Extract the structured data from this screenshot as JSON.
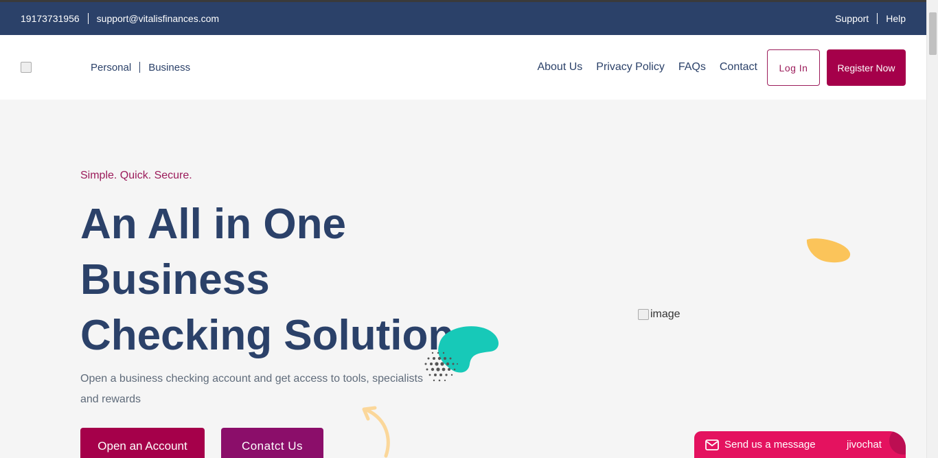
{
  "topbar": {
    "phone": "19173731956",
    "email": "support@vitalisfinances.com",
    "support": "Support",
    "help": "Help"
  },
  "header": {
    "segments": [
      "Personal",
      "Business"
    ],
    "nav": [
      "About Us",
      "Privacy Policy",
      "FAQs",
      "Contact"
    ],
    "login": "Log In",
    "register": "Register Now"
  },
  "hero": {
    "tagline": "Simple. Quick. Secure.",
    "title_lines": [
      "An All in One",
      "Business",
      "Checking Solution"
    ],
    "description": "Open a business checking account and get access to tools, specialists and rewards",
    "btn_open": "Open an Account",
    "btn_contact": "Conatct Us",
    "image_alt": "image"
  },
  "chat": {
    "message": "Send us a message",
    "brand": "jivochat"
  },
  "colors": {
    "navy": "#2b4169",
    "magenta": "#a5004a",
    "purple": "#8b0e6a",
    "teal": "#17c9b8",
    "yellow": "#fbc45a",
    "chat": "#e4125f"
  }
}
